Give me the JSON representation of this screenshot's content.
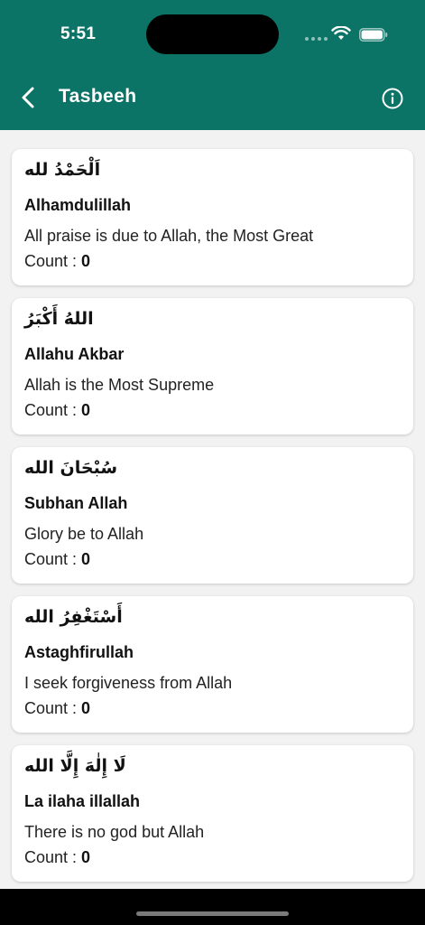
{
  "status_bar": {
    "time": "5:51"
  },
  "header": {
    "title": "Tasbeeh"
  },
  "count_label": "Count : ",
  "items": [
    {
      "arabic": "اَلْحَمْدُ لله",
      "name": "Alhamdulillah",
      "meaning": "All praise is due to Allah, the Most Great",
      "count": "0"
    },
    {
      "arabic": "اللهُ أَكْبَرُ",
      "name": "Allahu Akbar",
      "meaning": "Allah is the Most Supreme",
      "count": "0"
    },
    {
      "arabic": "سُبْحَانَ الله",
      "name": "Subhan Allah",
      "meaning": "Glory be to Allah",
      "count": "0"
    },
    {
      "arabic": "أَسْتَغْفِرُ الله",
      "name": "Astaghfirullah",
      "meaning": "I seek forgiveness from Allah",
      "count": "0"
    },
    {
      "arabic": "لَا إِلٰهَ إِلَّا الله",
      "name": "La ilaha illallah",
      "meaning": "There is no god but Allah",
      "count": "0"
    }
  ],
  "colors": {
    "header": "#0b7466",
    "background": "#f2f2f2",
    "card": "#ffffff"
  },
  "icons": {
    "back": "chevron-left-icon",
    "info": "info-circle-icon",
    "wifi": "wifi-icon",
    "battery": "battery-icon"
  }
}
